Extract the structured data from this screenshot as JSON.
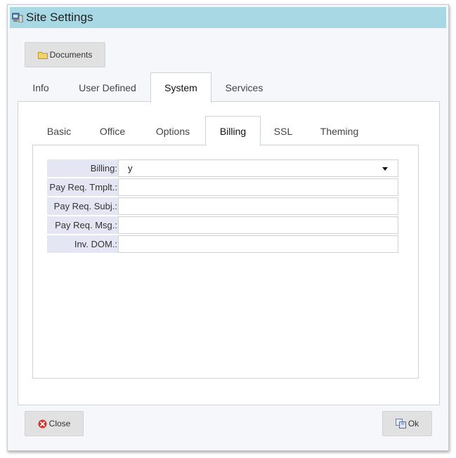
{
  "window": {
    "title": "Site Settings",
    "icon": "computer-icon"
  },
  "toolbar": {
    "documents_label": "Documents",
    "documents_icon": "folder-icon"
  },
  "tabs": [
    {
      "label": "Info"
    },
    {
      "label": "User Defined"
    },
    {
      "label": "System",
      "active": true
    },
    {
      "label": "Services"
    }
  ],
  "subtabs": [
    {
      "label": "Basic"
    },
    {
      "label": "Office"
    },
    {
      "label": "Options"
    },
    {
      "label": "Billing",
      "active": true
    },
    {
      "label": "SSL"
    },
    {
      "label": "Theming"
    }
  ],
  "billing_form": {
    "billing": {
      "label": "Billing:",
      "value": "y"
    },
    "pay_req_tmplt": {
      "label": "Pay Req. Tmplt.:",
      "value": ""
    },
    "pay_req_subj": {
      "label": "Pay Req. Subj.:",
      "value": ""
    },
    "pay_req_msg": {
      "label": "Pay Req. Msg.:",
      "value": ""
    },
    "inv_dom": {
      "label": "Inv. DOM.:",
      "value": ""
    }
  },
  "footer": {
    "close_label": "Close",
    "close_icon": "close-circle-icon",
    "ok_label": "Ok",
    "ok_icon": "save-icon"
  },
  "colors": {
    "titlebar": "#a8d8e4",
    "label_bg": "#e4e6f4",
    "close_icon": "#d9312b"
  }
}
